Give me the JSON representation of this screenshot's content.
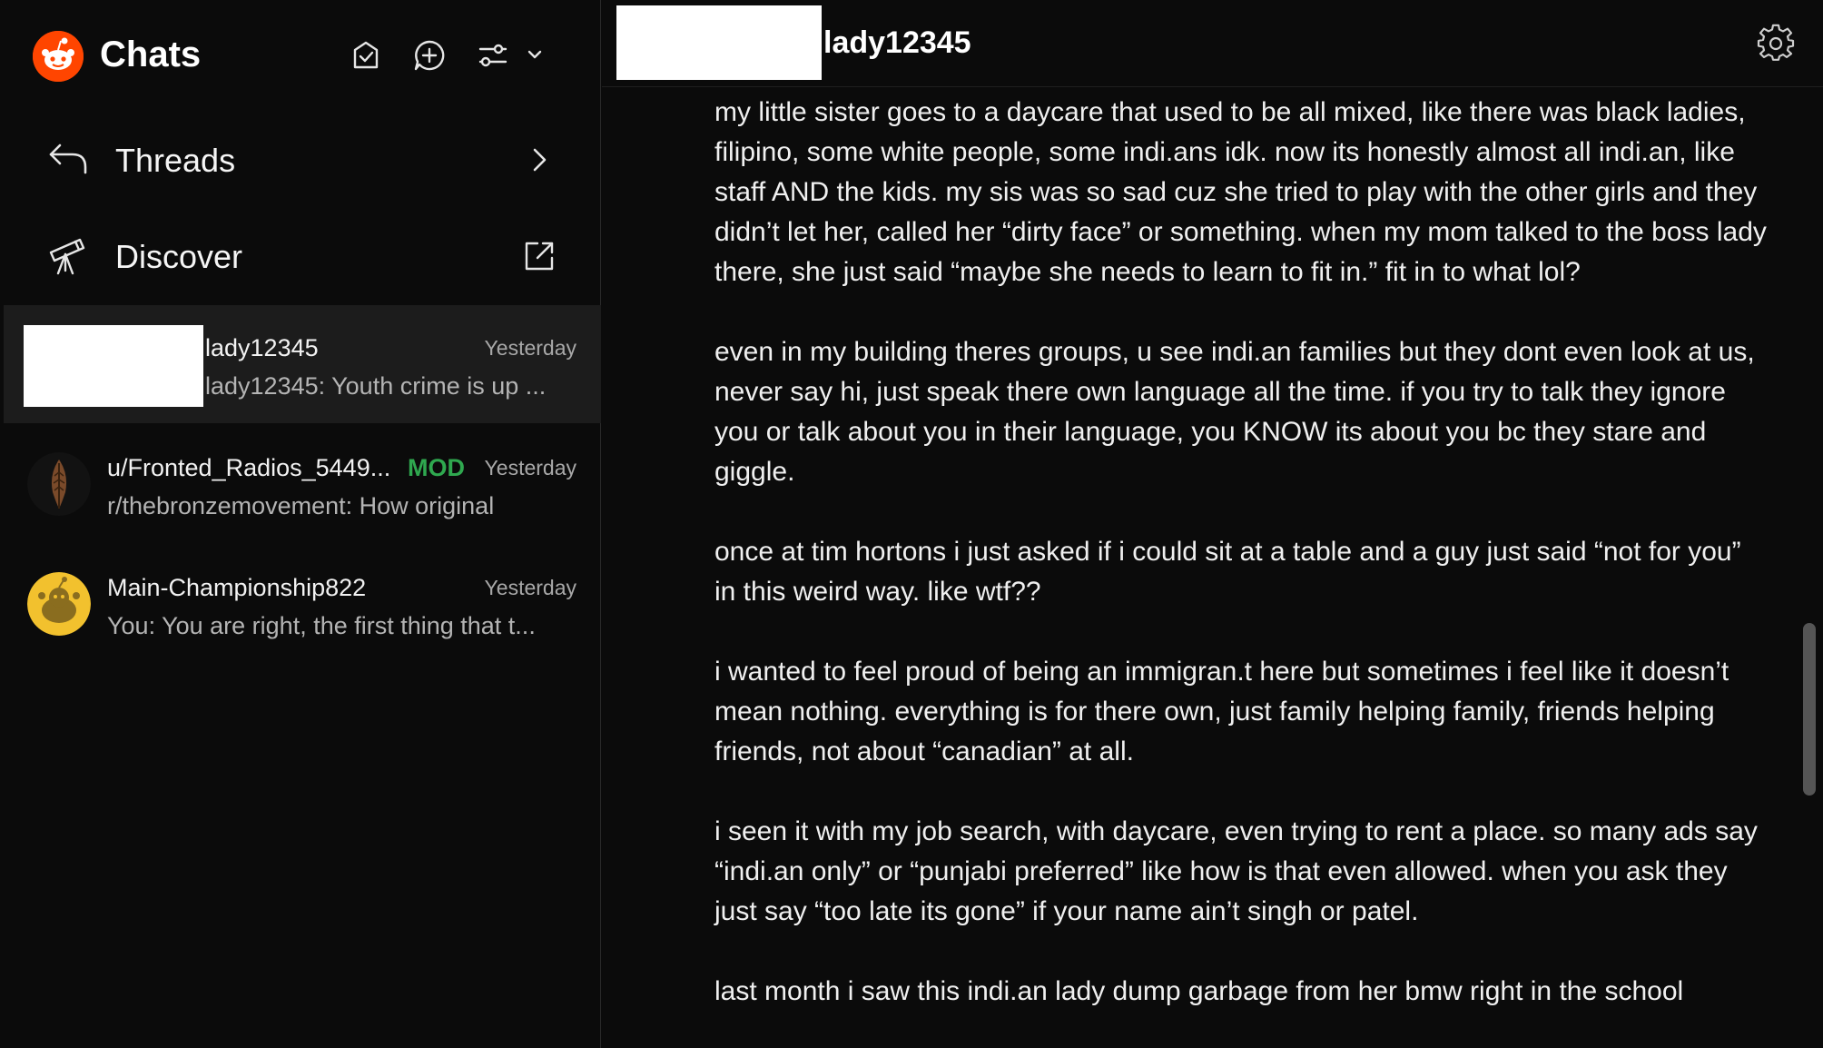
{
  "sidebar": {
    "title": "Chats",
    "nav": [
      {
        "label": "Threads",
        "icon": "reply-arrow-icon",
        "trail_icon": "chevron-right-icon"
      },
      {
        "label": "Discover",
        "icon": "telescope-icon",
        "trail_icon": "external-link-icon"
      }
    ],
    "chats": [
      {
        "name": "lady12345",
        "time": "Yesterday",
        "preview": "lady12345: Youth crime is up ...",
        "active": true
      },
      {
        "name": "u/Fronted_Radios_5449...",
        "badge": "MOD",
        "time": "Yesterday",
        "preview": "r/thebronzemovement: How original",
        "active": false
      },
      {
        "name": "Main-Championship822",
        "time": "Yesterday",
        "preview": "You: You are right, the first thing that t...",
        "active": false
      }
    ]
  },
  "conversation": {
    "title": "lady12345",
    "paragraphs": [
      "my little sister goes to a daycare that used to be all mixed, like there was black ladies, filipino, some white people, some indi.ans idk. now its honestly almost all indi.an, like staff AND the kids. my sis was so sad cuz she tried to play with the other girls and they didn’t let her, called her “dirty face” or something. when my mom talked to the boss lady there, she just said “maybe she needs to learn to fit in.” fit in to what lol?",
      "even in my building theres groups, u see indi.an families but they dont even look at us, never say hi, just speak there own language all the time. if you try to talk they ignore you or talk about you in their language, you KNOW its about you bc they stare and giggle.",
      "once at tim hortons i just asked if i could sit at a table and a guy just said “not for you” in this weird way. like wtf??",
      "i wanted to feel proud of being an immigran.t here but sometimes i feel like it doesn’t mean nothing. everything is for there own, just family helping family, friends helping friends, not about “canadian” at all.",
      "i seen it with my job search, with daycare, even trying to rent a place. so many ads say “indi.an only” or “punjabi preferred” like how is that even allowed. when you ask they just say “too late its gone” if your name ain’t singh or patel.",
      "last month i saw this indi.an lady dump garbage from her bmw right in the school"
    ]
  },
  "colors": {
    "background": "#0b0b0b",
    "accent": "#ff4500",
    "mod_badge": "#2fa84f",
    "active_row": "#1c1c1c"
  }
}
